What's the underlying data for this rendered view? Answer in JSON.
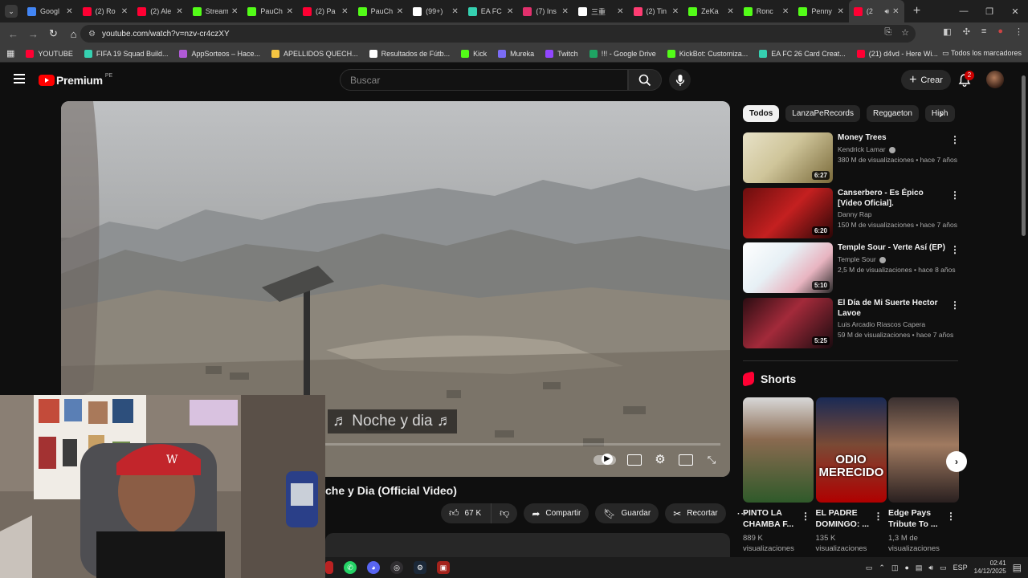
{
  "browser": {
    "tabs": [
      {
        "label": "Googl",
        "color": "#4285f4"
      },
      {
        "label": "(2) Ro",
        "color": "#ff0033"
      },
      {
        "label": "(2) Ale",
        "color": "#ff0033"
      },
      {
        "label": "Stream",
        "color": "#53fc18"
      },
      {
        "label": "PauCh",
        "color": "#53fc18"
      },
      {
        "label": "(2) Pa",
        "color": "#ff0033"
      },
      {
        "label": "PauCh",
        "color": "#53fc18"
      },
      {
        "label": "(99+) ",
        "color": "#ffffff"
      },
      {
        "label": "EA FC",
        "color": "#35d0b0"
      },
      {
        "label": "(7) Ins",
        "color": "#e1306c"
      },
      {
        "label": "三重",
        "color": "#ffffff"
      },
      {
        "label": "(2) Tin",
        "color": "#fe3c72"
      },
      {
        "label": "ZeKa",
        "color": "#53fc18"
      },
      {
        "label": "Ronc",
        "color": "#53fc18"
      },
      {
        "label": "Penny",
        "color": "#53fc18"
      },
      {
        "label": "(2",
        "color": "#ff0033"
      }
    ],
    "url": "youtube.com/watch?v=nzv-cr4czXY",
    "bookmarks": [
      {
        "label": "YOUTUBE",
        "color": "#ff0033"
      },
      {
        "label": "FIFA 19 Squad Build...",
        "color": "#35d0b0"
      },
      {
        "label": "AppSorteos – Hace...",
        "color": "#b05ad6"
      },
      {
        "label": "APELLIDOS QUECH...",
        "color": "#f5c542"
      },
      {
        "label": "Resultados de Fútb...",
        "color": "#ffffff"
      },
      {
        "label": "Kick",
        "color": "#53fc18"
      },
      {
        "label": "Mureka",
        "color": "#7b6cf6"
      },
      {
        "label": "Twitch",
        "color": "#9146ff"
      },
      {
        "label": "!!! - Google Drive",
        "color": "#1fa463"
      },
      {
        "label": "KickBot: Customiza...",
        "color": "#53fc18"
      },
      {
        "label": "EA FC 26 Card Creat...",
        "color": "#35d0b0"
      },
      {
        "label": "(21) d4vd - Here Wi...",
        "color": "#ff0033"
      }
    ],
    "all_bookmarks": "Todos los marcadores"
  },
  "youtube": {
    "logo_text": "Premium",
    "country": "PE",
    "search_placeholder": "Buscar",
    "create_label": "Crear",
    "notifications": "2",
    "video": {
      "lyric": "♬ Noche y dia ♬",
      "title": "che y Dia (Official Video)",
      "likes": "67 K",
      "share": "Compartir",
      "save": "Guardar",
      "clip": "Recortar"
    },
    "chips": [
      "Todos",
      "LanzaPeRecords",
      "Reggaeton",
      "Hiph"
    ],
    "recommendations": [
      {
        "title": "Money Trees",
        "channel": "Kendrick Lamar",
        "verified": true,
        "meta": "380 M de visualizaciones • hace 7 años",
        "duration": "6:27"
      },
      {
        "title": "Canserbero - Es Épico [Video Oficial].",
        "channel": "Danny Rap",
        "verified": false,
        "meta": "150 M de visualizaciones • hace 7 años",
        "duration": "6:20"
      },
      {
        "title": "Temple Sour - Verte Así (EP)",
        "channel": "Temple Sour",
        "verified": true,
        "meta": "2,5 M de visualizaciones • hace 8 años",
        "duration": "5:10"
      },
      {
        "title": "El Día de Mi Suerte   Hector Lavoe",
        "channel": "Luis Arcadio Riascos Capera",
        "verified": false,
        "meta": "59 M de visualizaciones • hace 7 años",
        "duration": "5:25"
      }
    ],
    "shorts_heading": "Shorts",
    "shorts": [
      {
        "title": "PINTO LA CHAMBA F...",
        "views": "889 K visualizaciones"
      },
      {
        "title": "EL PADRE DOMINGO: ...",
        "views": "135 K visualizaciones"
      },
      {
        "title": "Edge Pays Tribute To ...",
        "views": "1,3 M de visualizaciones"
      }
    ],
    "short_thumb_text": "ODIO\nMERECIDO"
  },
  "taskbar": {
    "lang": "ESP",
    "time": "02:41",
    "date": "14/12/2025"
  }
}
